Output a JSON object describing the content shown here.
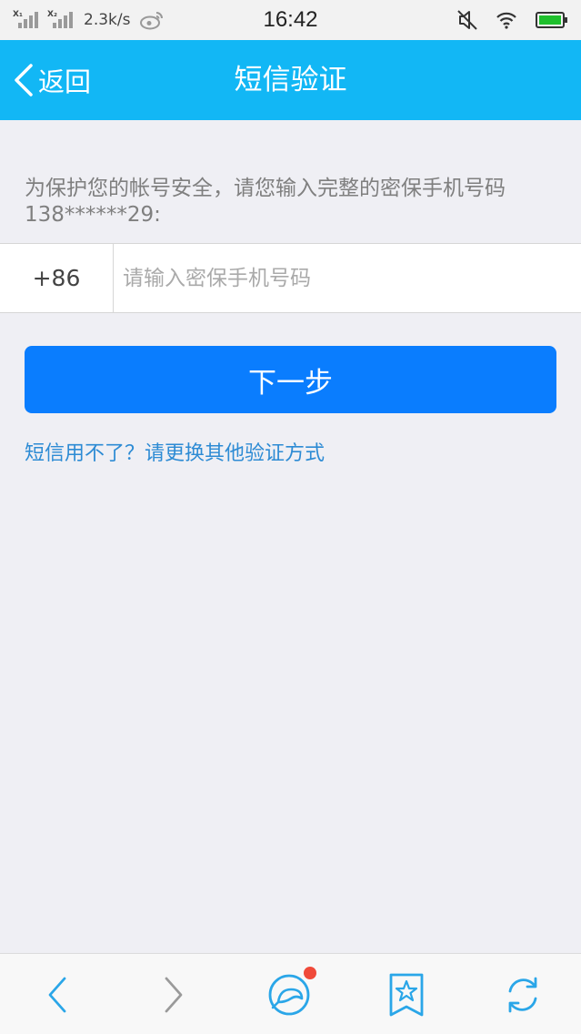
{
  "status_bar": {
    "sim1_label": "X₁",
    "sim2_label": "X₂",
    "net_speed": "2.3k/s",
    "time": "16:42",
    "icons": [
      "signal-icon",
      "signal-icon",
      "weibo-icon",
      "mute-icon",
      "wifi-icon",
      "battery-icon"
    ]
  },
  "nav": {
    "back_label": "返回",
    "title": "短信验证"
  },
  "content": {
    "hint": "为保护您的帐号安全，请您输入完整的密保手机号码138******29:",
    "country_code": "+86",
    "phone_placeholder": "请输入密保手机号码",
    "phone_value": "",
    "next_button": "下一步",
    "alt_link": "短信用不了？请更换其他验证方式"
  },
  "toolbar": {
    "items": [
      "back-icon",
      "forward-icon",
      "qq-chat-icon",
      "bookmark-star-icon",
      "refresh-icon"
    ],
    "has_notification_dot": true
  },
  "colors": {
    "nav_bg": "#12b7f5",
    "primary_button": "#0a7dfe",
    "link": "#2d8bd4",
    "icon_blue": "#2aa6e8",
    "notification": "#f04a3a",
    "page_bg": "#efeff4"
  }
}
